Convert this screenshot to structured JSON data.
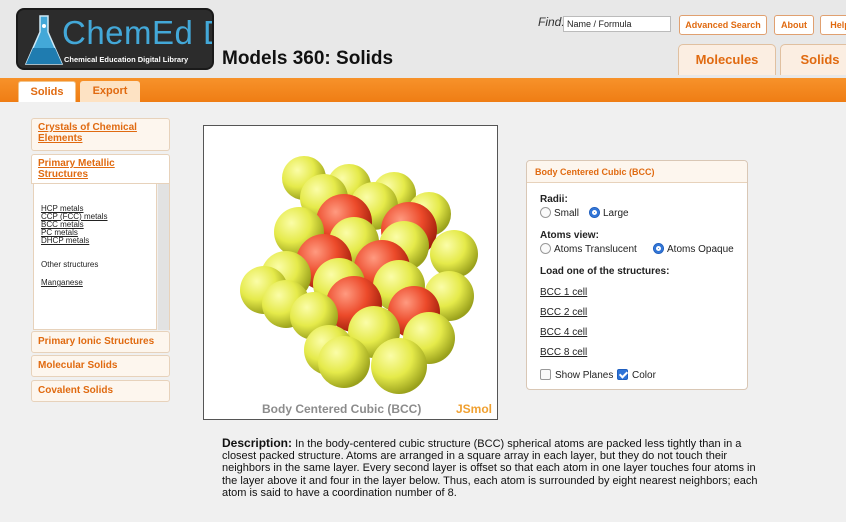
{
  "header": {
    "logo_title": "ChemEd DL",
    "logo_subtitle": "Chemical Education Digital Library",
    "page_title": "Models 360: Solids",
    "find_label": "Find:",
    "find_placeholder": "Name / Formula",
    "advanced_search": "Advanced Search",
    "about": "About",
    "help": "Help",
    "module_tabs": [
      {
        "label": "Molecules"
      },
      {
        "label": "Solids"
      }
    ]
  },
  "tabs": [
    {
      "label": "Solids"
    },
    {
      "label": "Export"
    }
  ],
  "sidebar": {
    "crystals": "Crystals of Chemical Elements",
    "crystals_lines": [
      "Crystals of Chemical",
      "Elements"
    ],
    "metallic_lines": [
      "Primary Metallic",
      "Structures"
    ],
    "metallic_items": [
      "HCP metals",
      "CCP (FCC) metals",
      "BCC metals",
      "PC metals",
      "DHCP metals"
    ],
    "other_structures": "Other structures",
    "manganese": "Manganese",
    "ionic": "Primary Ionic Structures",
    "molecular": "Molecular Solids",
    "covalent": "Covalent Solids"
  },
  "viewer": {
    "caption": "Body Centered Cubic (BCC)",
    "brand": "JSmol",
    "atom_colors": {
      "corner": "#e5ea4a",
      "center": "#ec4a2a"
    }
  },
  "panel": {
    "title": "Body Centered Cubic (BCC)",
    "radii_label": "Radii:",
    "radii_options": [
      "Small",
      "Large"
    ],
    "radii_selected": "Large",
    "view_label": "Atoms view:",
    "view_options": [
      "Atoms Translucent",
      "Atoms Opaque"
    ],
    "view_selected": "Atoms Opaque",
    "load_label": "Load one of the structures:",
    "cells": [
      "BCC 1 cell",
      "BCC 2 cell",
      "BCC 4 cell",
      "BCC 8 cell"
    ],
    "show_planes": "Show Planes",
    "show_planes_checked": false,
    "color": "Color",
    "color_checked": true
  },
  "description": {
    "label": "Description:",
    "text": "In the body-centered cubic structure (BCC) spherical atoms are packed less tightly than in a closest packed structure. Atoms are arranged in a square array in each layer, but they do not touch their neighbors in the same layer. Every second layer is offset so that each atom in one layer touches four atoms in the layer above it and four in the layer below. Thus, each atom is surrounded by eight nearest neighbors; each atom is said to have a coordination number of 8."
  },
  "colors": {
    "accent_orange": "#ef7d14",
    "link_orange": "#e06a10",
    "logo_blue": "#43a8d8",
    "checkbox_blue": "#2e74d8"
  }
}
